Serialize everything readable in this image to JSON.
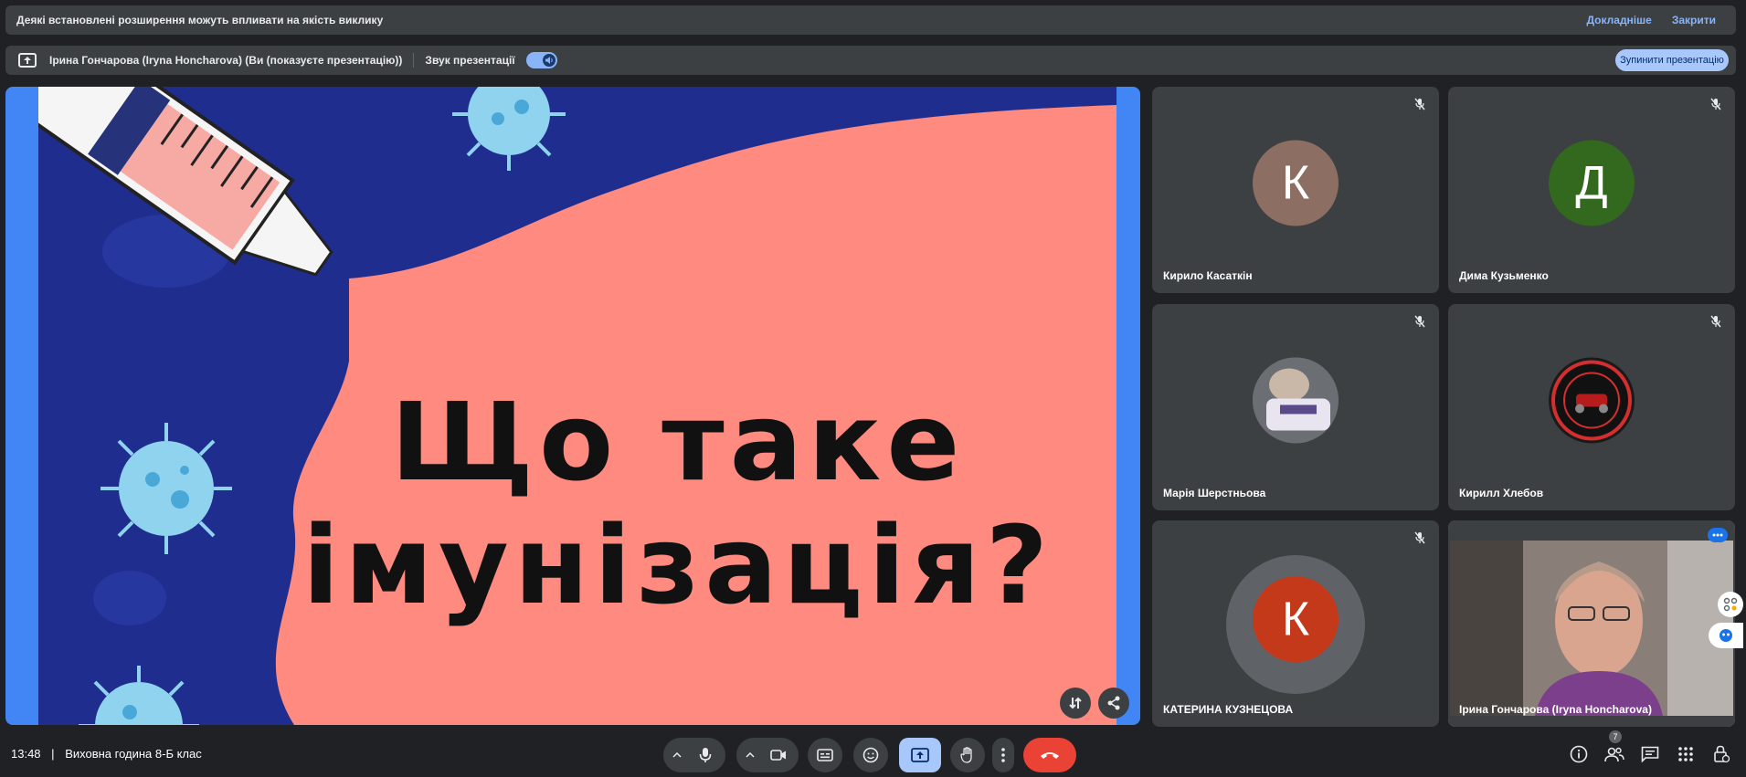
{
  "banner": {
    "message": "Деякі встановлені розширення можуть впливати на якість виклику",
    "details_link": "Докладніше",
    "close_link": "Закрити"
  },
  "presenting": {
    "presenter_text": "Ірина Гончарова (Iryna Honcharova) (Ви (показуєте презентацію))",
    "sound_label": "Звук презентації",
    "sound_toggle_on": true,
    "stop_button": "Зупинити презентацію"
  },
  "slide": {
    "line1": "Що таке",
    "line2": "імунізація?"
  },
  "participants": [
    {
      "name": "Кирило Касаткін",
      "initial": "К",
      "avatar_color": "#8d6e63"
    },
    {
      "name": "Дима Кузьменко",
      "initial": "Д",
      "avatar_color": "#33691e"
    },
    {
      "name": "Марія Шерстньова",
      "initial": "",
      "avatar_color": "#5f6368"
    },
    {
      "name": "Кирилл Хлебов",
      "initial": "",
      "avatar_color": "#1a1a1a"
    },
    {
      "name": "КАТЕРИНА КУЗНЕЦОВА",
      "initial": "К",
      "avatar_color": "#c5391b"
    },
    {
      "name": "Ірина Гончарова (Iryna Honcharova)",
      "initial": "",
      "avatar_color": "#6d5a4f"
    }
  ],
  "footer": {
    "time": "13:48",
    "separator": "|",
    "meeting_title": "Виховна година 8-Б клас",
    "participants_count": "7"
  },
  "colors": {
    "accent": "#8ab4f8",
    "end_call": "#ea4335",
    "stage_border": "#4285f4",
    "slide_pink": "#ff8a80"
  }
}
